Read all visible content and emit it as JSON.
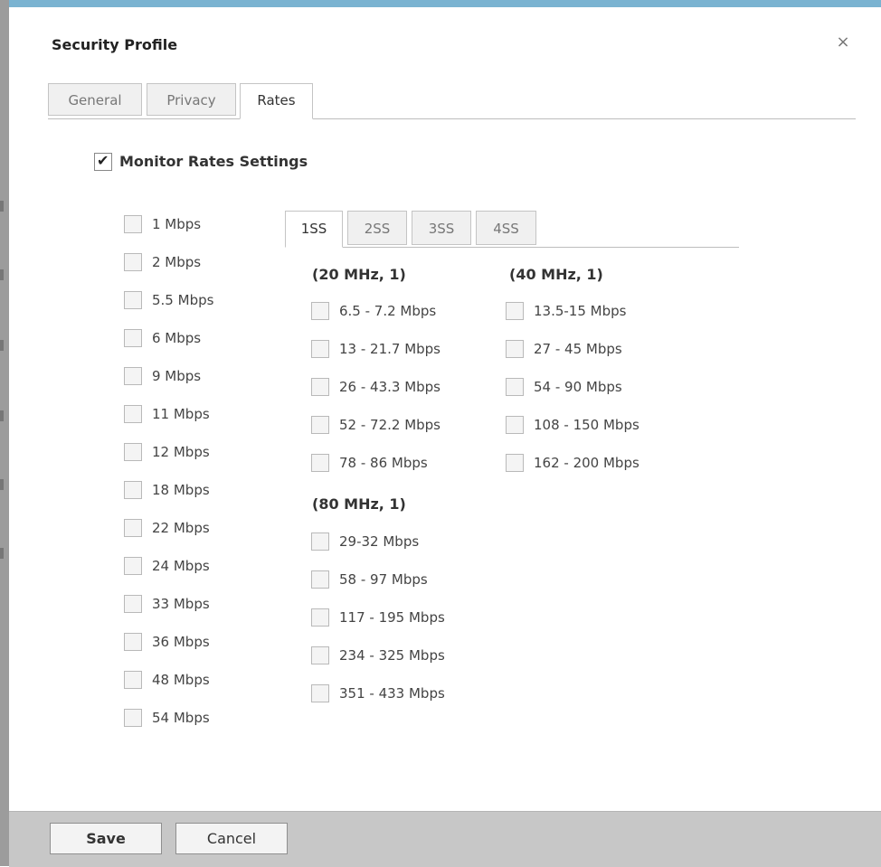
{
  "dialog": {
    "title": "Security Profile",
    "close_icon": "×"
  },
  "tabs": [
    {
      "label": "General",
      "active": false
    },
    {
      "label": "Privacy",
      "active": false
    },
    {
      "label": "Rates",
      "active": true
    }
  ],
  "monitor": {
    "label": "Monitor Rates Settings",
    "checked": true
  },
  "legacy_rates": [
    "1 Mbps",
    "2 Mbps",
    "5.5 Mbps",
    "6 Mbps",
    "9 Mbps",
    "11 Mbps",
    "12 Mbps",
    "18 Mbps",
    "22 Mbps",
    "24 Mbps",
    "33 Mbps",
    "36 Mbps",
    "48 Mbps",
    "54 Mbps"
  ],
  "ss_tabs": [
    {
      "label": "1SS",
      "active": true
    },
    {
      "label": "2SS",
      "active": false
    },
    {
      "label": "3SS",
      "active": false
    },
    {
      "label": "4SS",
      "active": false
    }
  ],
  "groups": {
    "mhz20": {
      "heading": "(20 MHz, 1)",
      "rates": [
        "6.5 - 7.2 Mbps",
        "13 - 21.7 Mbps",
        "26 - 43.3 Mbps",
        "52 - 72.2 Mbps",
        "78 - 86 Mbps"
      ]
    },
    "mhz40": {
      "heading": "(40 MHz, 1)",
      "rates": [
        "13.5-15 Mbps",
        "27 - 45 Mbps",
        "54 - 90 Mbps",
        "108 - 150 Mbps",
        "162 - 200 Mbps"
      ]
    },
    "mhz80": {
      "heading": "(80 MHz, 1)",
      "rates": [
        "29-32 Mbps",
        "58 - 97 Mbps",
        "117 - 195 Mbps",
        "234 - 325 Mbps",
        "351 - 433 Mbps"
      ]
    }
  },
  "footer": {
    "save_label": "Save",
    "cancel_label": "Cancel"
  }
}
